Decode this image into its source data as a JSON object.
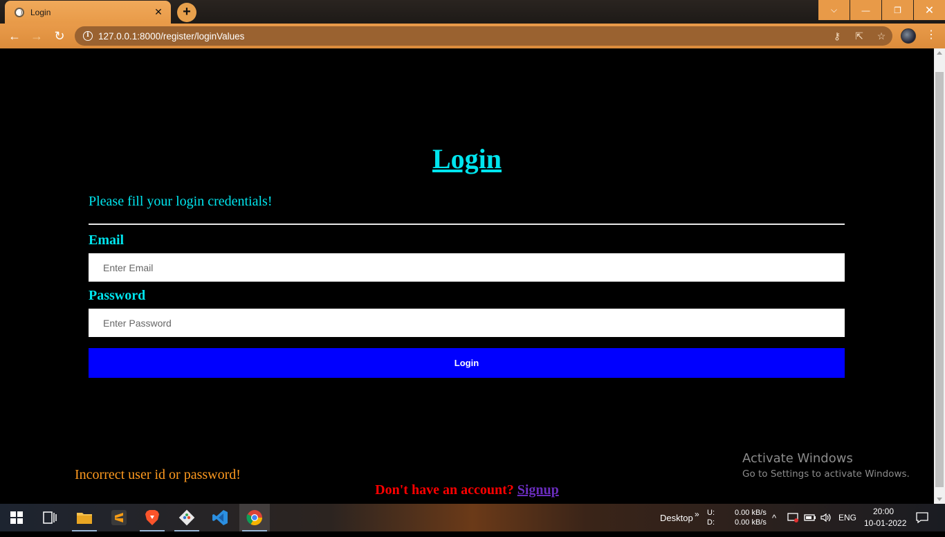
{
  "browser": {
    "tab_title": "Login",
    "tab_close": "✕",
    "new_tab": "+",
    "url": "127.0.0.1:8000/register/loginValues",
    "window_controls": {
      "list": "⌵",
      "minimize": "—",
      "restore": "❐",
      "close": "✕"
    },
    "nav": {
      "back": "←",
      "forward": "→",
      "reload": "↻",
      "menu": "⋮"
    },
    "omnibox_icons": {
      "key": "⚷",
      "share": "⇱",
      "star": "☆"
    }
  },
  "page": {
    "heading": "Login",
    "subtitle": "Please fill your login credentials!",
    "email_label": "Email",
    "email_placeholder": "Enter Email",
    "password_label": "Password",
    "password_placeholder": "Enter Password",
    "login_button": "Login",
    "error_message": "Incorrect user id or password!",
    "signup_prompt": "Don't have an account? ",
    "signup_link": "Signup"
  },
  "watermark": {
    "line1": "Activate Windows",
    "line2": "Go to Settings to activate Windows."
  },
  "taskbar": {
    "apps": [
      "start-icon",
      "task-view-icon",
      "file-explorer-icon",
      "sublime-text-icon",
      "brave-icon",
      "git-icon",
      "vscode-icon",
      "chrome-icon"
    ],
    "desktop_label": "Desktop",
    "chevron": "»",
    "net_upload_label": "U:",
    "net_download_label": "D:",
    "net_upload": "0.00 kB/s",
    "net_download": "0.00 kB/s",
    "tray_up": "^",
    "language": "ENG",
    "time": "20:00",
    "date": "10-01-2022"
  },
  "colors": {
    "accent_cyan": "#00e5ee",
    "button_blue": "#0000ff",
    "error_orange": "#ff9a1f",
    "signup_red": "#ff0000",
    "chrome_orange": "#e89a48"
  }
}
